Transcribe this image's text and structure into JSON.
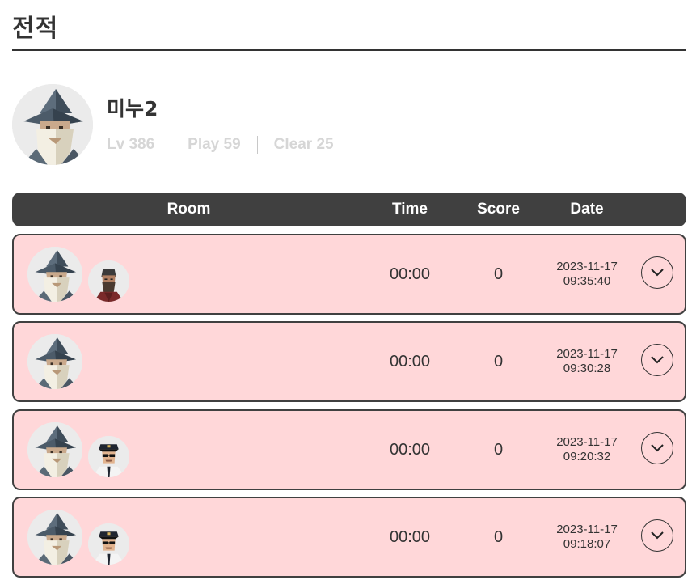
{
  "page": {
    "title": "전적"
  },
  "profile": {
    "name": "미누2",
    "level": "Lv 386",
    "play": "Play 59",
    "clear": "Clear 25"
  },
  "table": {
    "headers": {
      "room": "Room",
      "time": "Time",
      "score": "Score",
      "date": "Date"
    },
    "rows": [
      {
        "time": "00:00",
        "score": "0",
        "date": "2023-11-17",
        "clock": "09:35:40",
        "companion": "bearded-man"
      },
      {
        "time": "00:00",
        "score": "0",
        "date": "2023-11-17",
        "clock": "09:30:28",
        "companion": ""
      },
      {
        "time": "00:00",
        "score": "0",
        "date": "2023-11-17",
        "clock": "09:20:32",
        "companion": "police-officer"
      },
      {
        "time": "00:00",
        "score": "0",
        "date": "2023-11-17",
        "clock": "09:18:07",
        "companion": "police-officer"
      }
    ]
  },
  "colors": {
    "row_background": "#ffd7d9",
    "header_background": "#404040",
    "stat_text": "#d6d6d6"
  }
}
